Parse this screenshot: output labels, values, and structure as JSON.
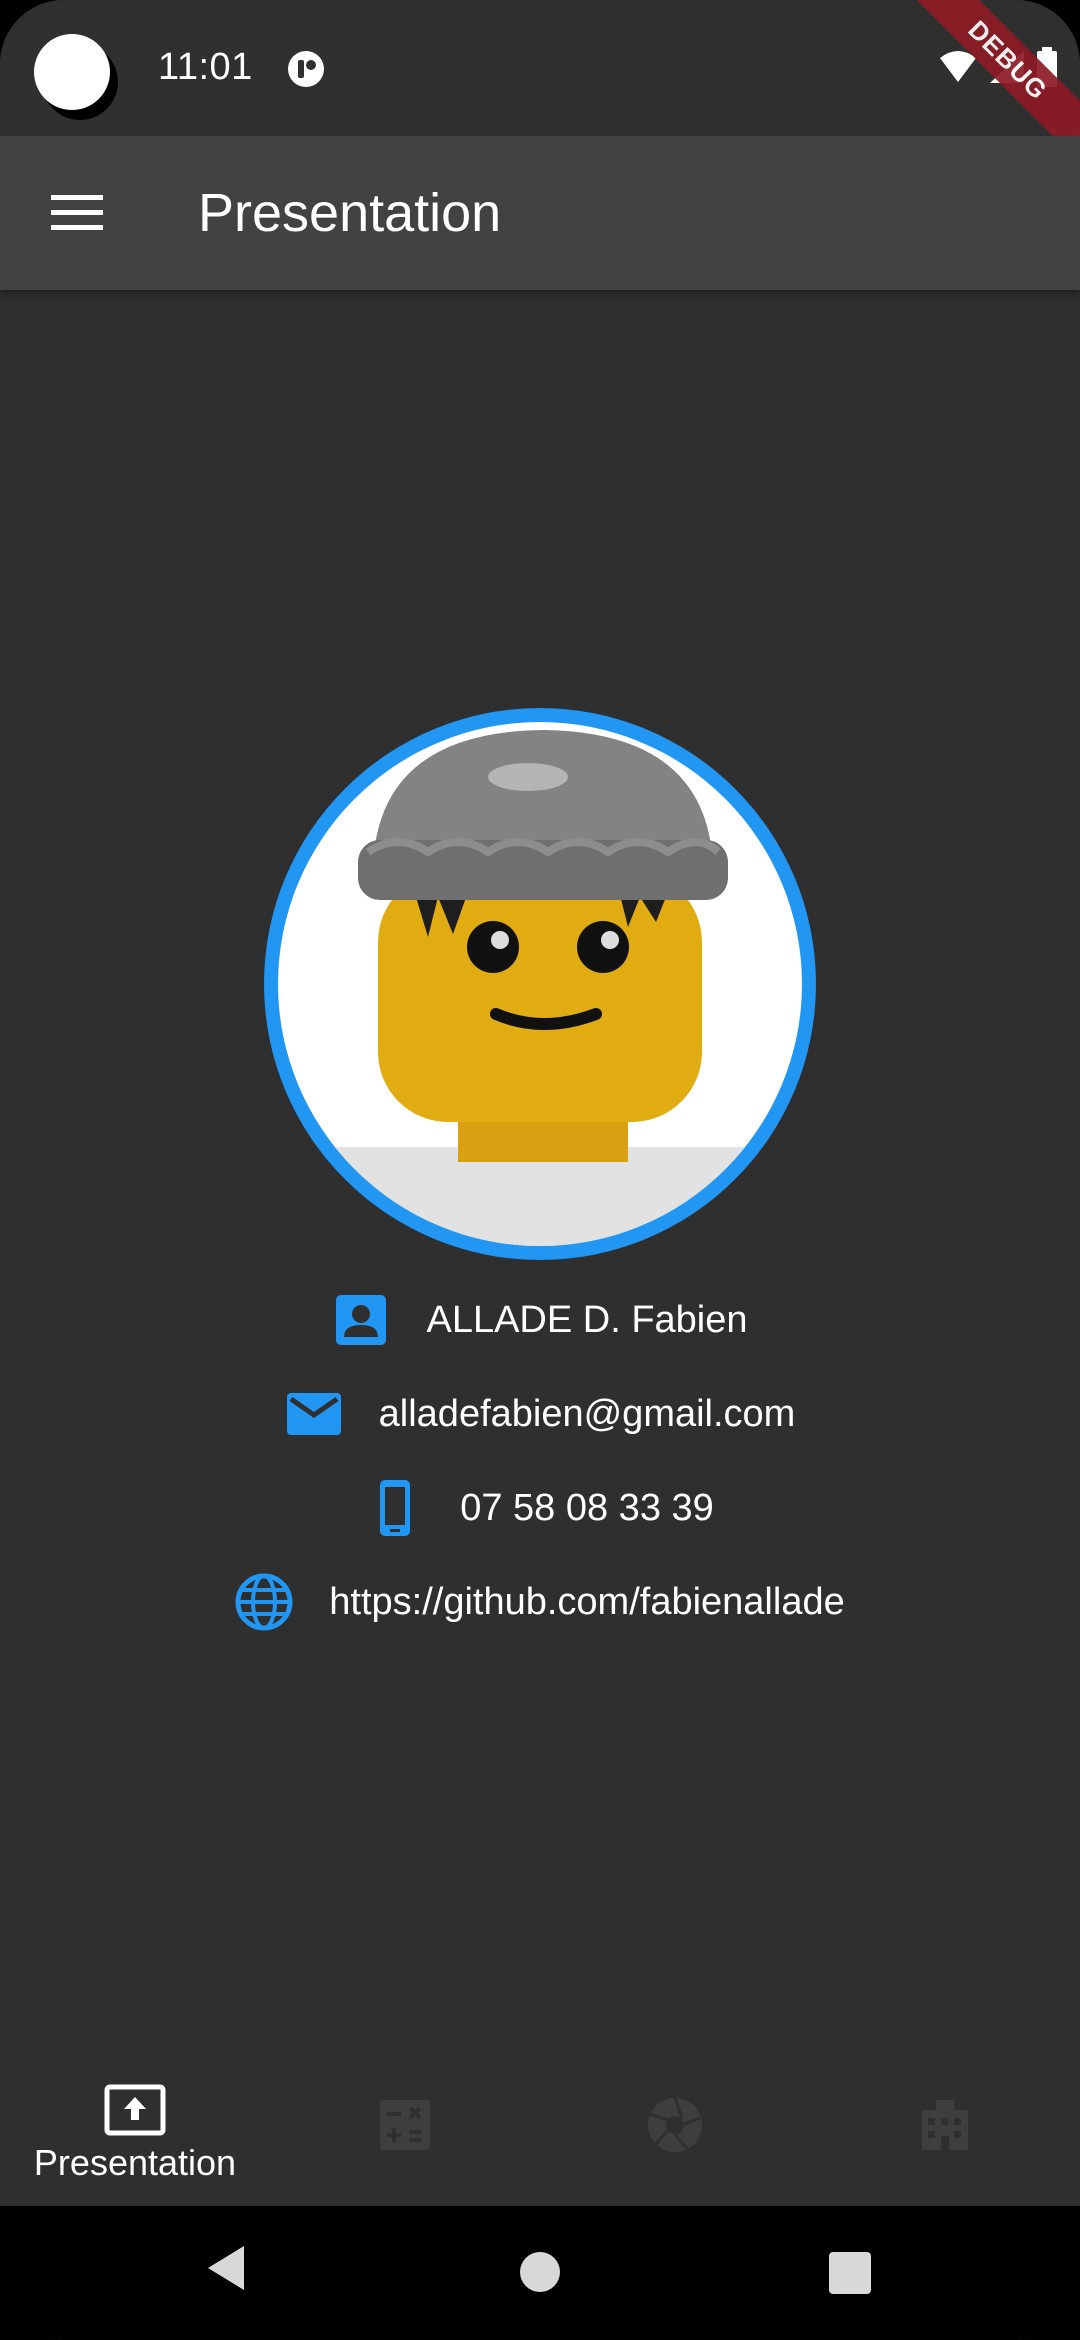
{
  "status_bar": {
    "time": "11:01",
    "debug_label": "DEBUG",
    "icons": [
      "app-notification-icon",
      "wifi-icon",
      "cell-signal-icon",
      "battery-icon"
    ]
  },
  "app_bar": {
    "title": "Presentation",
    "menu_icon": "hamburger-menu-icon"
  },
  "profile": {
    "avatar": "lego-minifigure-avatar",
    "accent_color": "#2196f3",
    "contacts": [
      {
        "icon": "contact-card-icon",
        "text": "ALLADE D. Fabien"
      },
      {
        "icon": "email-icon",
        "text": "alladefabien@gmail.com"
      },
      {
        "icon": "phone-icon",
        "text": "07 58 08 33 39"
      },
      {
        "icon": "globe-icon",
        "text": "https://github.com/fabienallade"
      }
    ]
  },
  "bottom_nav": {
    "items": [
      {
        "icon": "presentation-upload-icon",
        "label": "Presentation",
        "selected": true
      },
      {
        "icon": "calculator-icon",
        "label": "",
        "selected": false
      },
      {
        "icon": "camera-aperture-icon",
        "label": "",
        "selected": false
      },
      {
        "icon": "building-icon",
        "label": "",
        "selected": false
      }
    ]
  },
  "system_nav": [
    "back-icon",
    "home-icon",
    "recents-icon"
  ],
  "colors": {
    "background": "#2f2f30",
    "app_bar": "#424242",
    "accent": "#2196f3",
    "debug_banner": "#8e1b24"
  }
}
